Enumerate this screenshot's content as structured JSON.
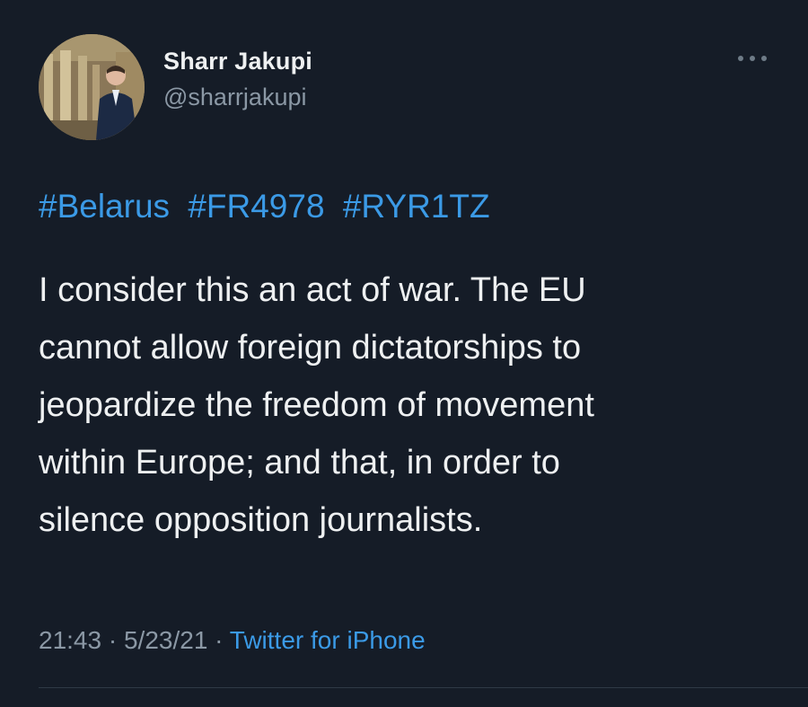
{
  "author": {
    "display_name": "Sharr Jakupi",
    "handle": "@sharrjakupi"
  },
  "hashtags": [
    "#Belarus",
    "#FR4978",
    "#RYR1TZ"
  ],
  "tweet_text_lines": [
    "I consider this an act of war. The EU",
    "cannot allow foreign dictatorships to",
    "jeopardize the freedom of movement",
    "within Europe; and that, in order to",
    "silence opposition journalists."
  ],
  "meta": {
    "time": "21:43",
    "separator": " · ",
    "date": "5/23/21",
    "source": "Twitter for iPhone"
  },
  "icons": {
    "more": "more-horizontal-icon"
  },
  "colors": {
    "background": "#151c27",
    "text": "#eef0f1",
    "secondary": "#8b98a5",
    "accent": "#3b9ae6"
  }
}
